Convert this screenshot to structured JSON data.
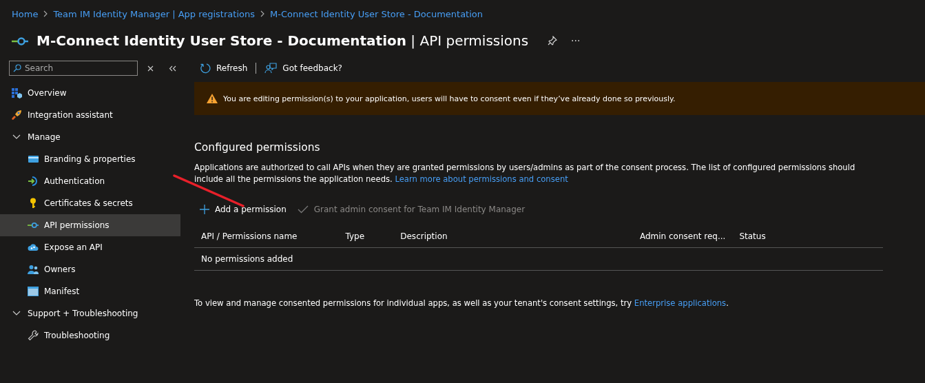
{
  "breadcrumb": [
    "Home",
    "Team IM Identity Manager | App registrations",
    "M-Connect Identity User Store - Documentation"
  ],
  "title": "**M-Connect Identity User Store - Documentation** | API permissions",
  "title_actions": {
    "more": "···"
  },
  "search": {
    "placeholder": "Search"
  },
  "sidebar": {
    "items": [
      {
        "kind": "item",
        "label": "Overview",
        "selected": false
      },
      {
        "kind": "item",
        "label": "Integration assistant",
        "selected": false
      },
      {
        "kind": "group",
        "label": "Manage",
        "expanded": true,
        "children": [
          {
            "kind": "item",
            "label": "Branding & properties",
            "selected": false
          },
          {
            "kind": "item",
            "label": "Authentication",
            "selected": false
          },
          {
            "kind": "item",
            "label": "Certificates & secrets",
            "selected": false
          },
          {
            "kind": "item",
            "label": "API permissions",
            "selected": true
          },
          {
            "kind": "item",
            "label": "Expose an API",
            "selected": false
          },
          {
            "kind": "item",
            "label": "Owners",
            "selected": false
          },
          {
            "kind": "item",
            "label": "Manifest",
            "selected": false
          }
        ]
      },
      {
        "kind": "group",
        "label": "Support + Troubleshooting",
        "expanded": true,
        "children": [
          {
            "kind": "item",
            "label": "Troubleshooting",
            "selected": false
          }
        ]
      }
    ]
  },
  "toolbar": [
    {
      "label": "Refresh"
    },
    {
      "label": "Got feedback?"
    }
  ],
  "warning": "You are editing permission(s) to your application, users will have to consent even if they’ve already done so previously.",
  "section": {
    "title": "Configured permissions",
    "text": "Applications are authorized to call APIs when they are granted permissions by users/admins as part of the consent process. The list of configured permissions should include all the permissions the application needs.",
    "link": "Learn more about permissions and consent"
  },
  "actions": [
    {
      "label": "Add a permission",
      "disabled": false
    },
    {
      "label": "Grant admin consent for Team IM Identity Manager",
      "disabled": true
    }
  ],
  "table": {
    "columns": [
      "API / Permissions name",
      "Type",
      "Description",
      "Admin consent req...",
      "Status"
    ],
    "empty": "No permissions added"
  },
  "footer": {
    "text": "To view and manage consented permissions for individual apps, as well as your tenant's consent settings, try",
    "link": "Enterprise applications",
    "end": "."
  }
}
